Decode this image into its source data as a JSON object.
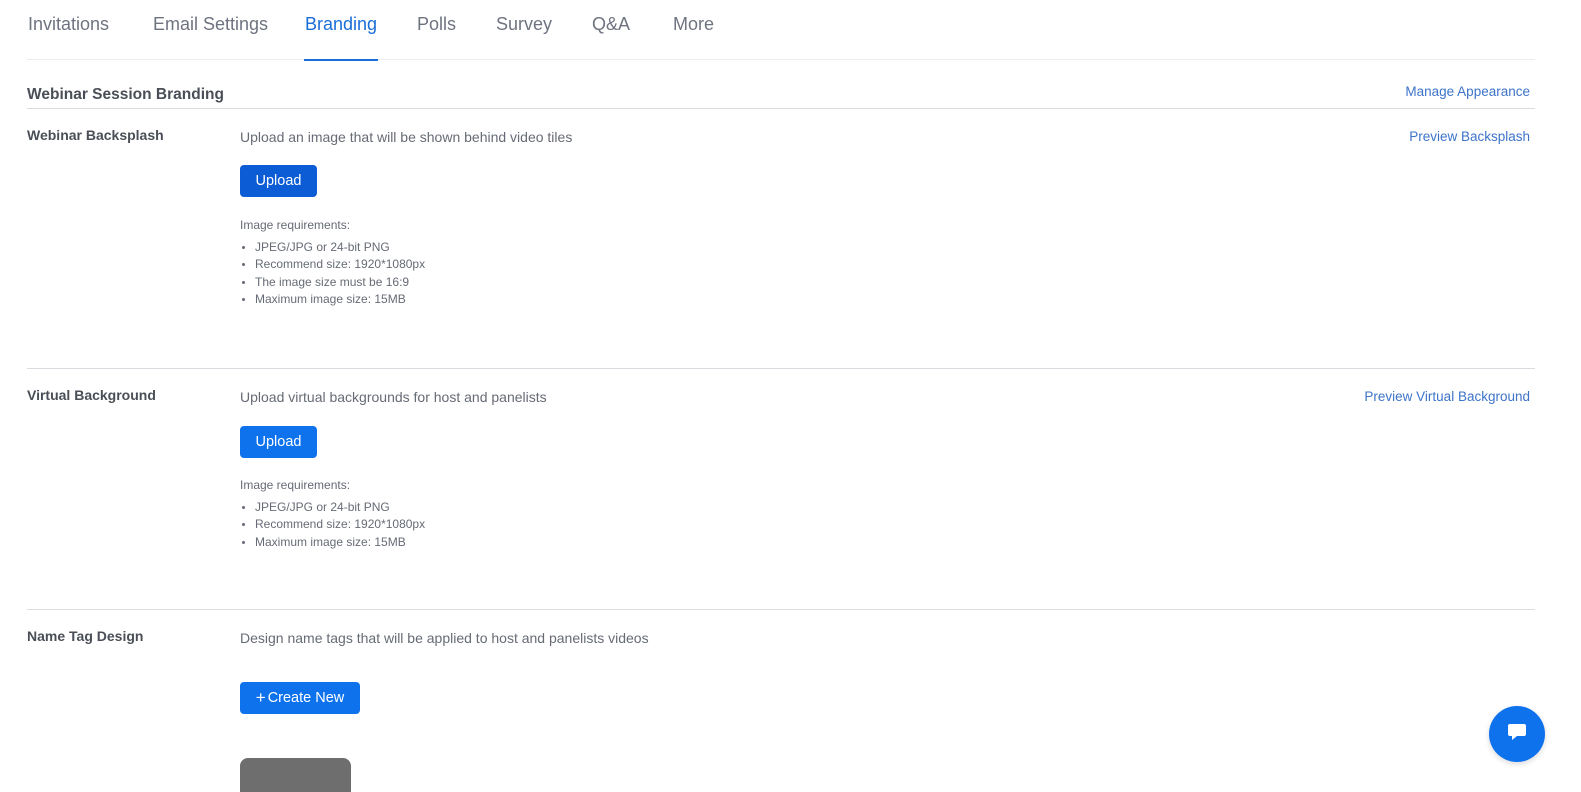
{
  "tabs": [
    {
      "label": "Invitations",
      "active": false
    },
    {
      "label": "Email Settings",
      "active": false
    },
    {
      "label": "Branding",
      "active": true
    },
    {
      "label": "Polls",
      "active": false
    },
    {
      "label": "Survey",
      "active": false
    },
    {
      "label": "Q&A",
      "active": false
    },
    {
      "label": "More",
      "active": false
    }
  ],
  "section": {
    "title": "Webinar Session Branding",
    "manage_link": "Manage Appearance"
  },
  "backsplash": {
    "label": "Webinar Backsplash",
    "description": "Upload an image that will be shown behind video tiles",
    "preview_link": "Preview Backsplash",
    "upload_label": "Upload",
    "requirements_title": "Image requirements:",
    "requirements": [
      "JPEG/JPG or 24-bit PNG",
      "Recommend size: 1920*1080px",
      "The image size must be 16:9",
      "Maximum image size: 15MB"
    ]
  },
  "virtual_background": {
    "label": "Virtual Background",
    "description": "Upload virtual backgrounds for host and panelists",
    "preview_link": "Preview Virtual Background",
    "upload_label": "Upload",
    "requirements_title": "Image requirements:",
    "requirements": [
      "JPEG/JPG or 24-bit PNG",
      "Recommend size: 1920*1080px",
      "Maximum image size: 15MB"
    ]
  },
  "name_tag": {
    "label": "Name Tag Design",
    "description": "Design name tags that will be applied to host and panelists videos",
    "create_plus": "+",
    "create_label": "Create New"
  },
  "colors": {
    "accent": "#0e72ed",
    "link": "#3d74c9",
    "active_tab": "#1a6ed8"
  },
  "icons": {
    "chat_fab": "chat-bubble-icon"
  }
}
